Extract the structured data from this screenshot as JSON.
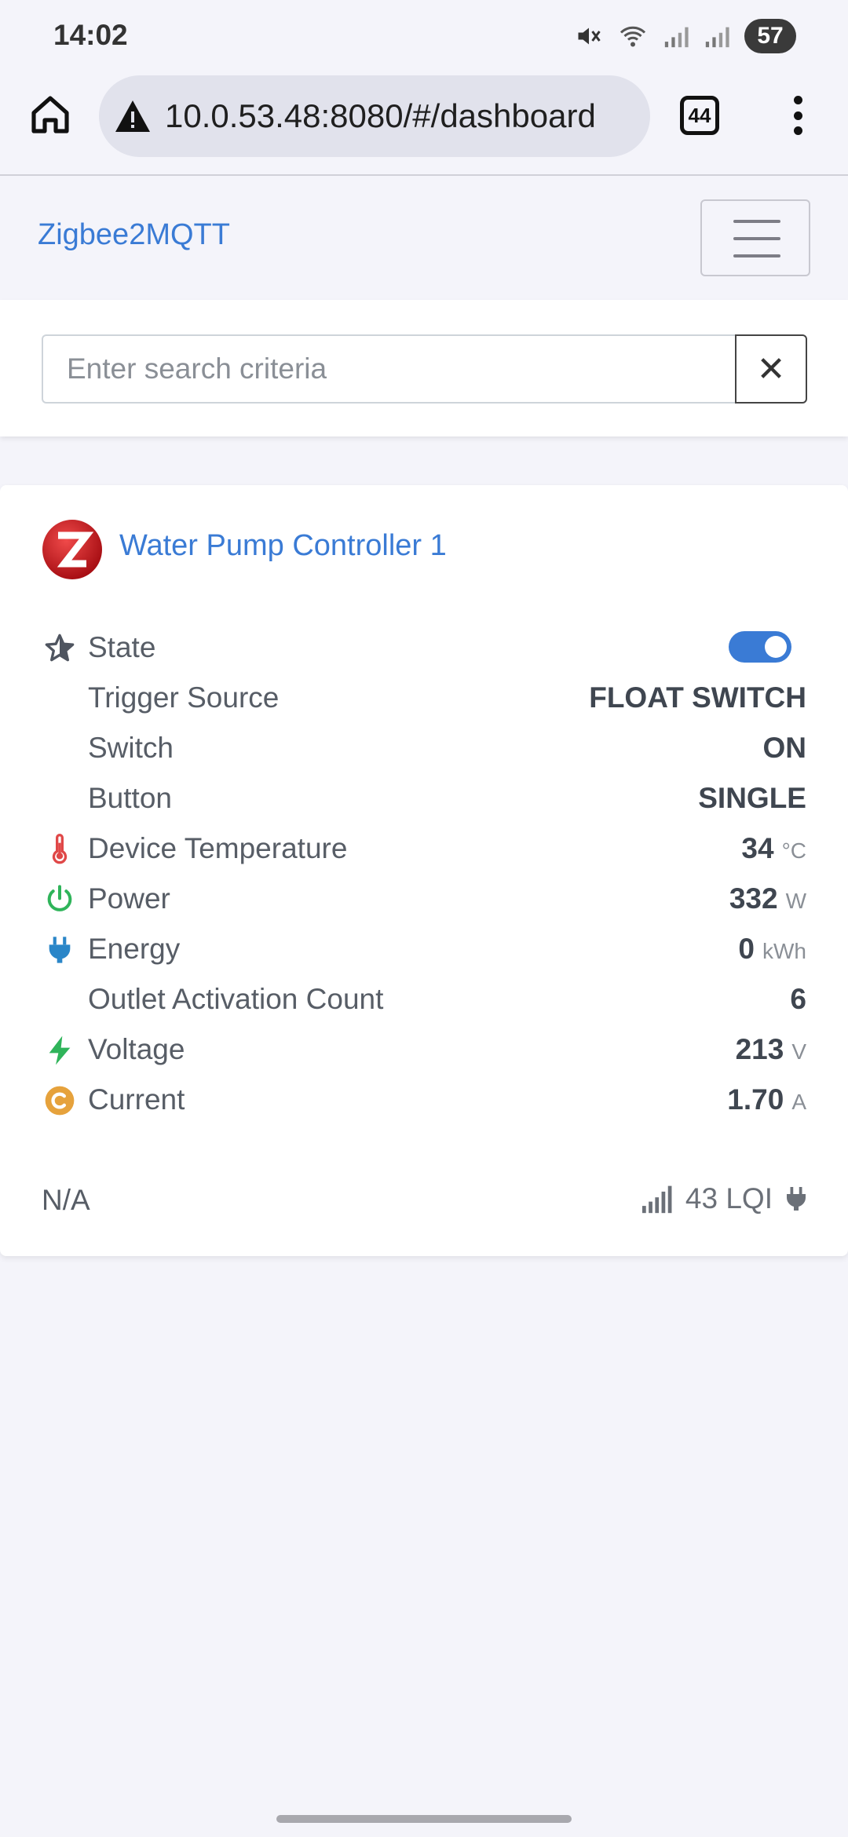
{
  "status_bar": {
    "time": "14:02",
    "battery": "57",
    "icons": [
      "mute-icon",
      "wifi-icon",
      "signal-icon",
      "signal-icon"
    ]
  },
  "browser": {
    "url": "10.0.53.48:8080/#/dashboard",
    "tab_count": "44"
  },
  "navbar": {
    "brand": "Zigbee2MQTT"
  },
  "search": {
    "placeholder": "Enter search criteria",
    "clear_label": "✕"
  },
  "device": {
    "name": "Water Pump Controller 1",
    "state_on": true,
    "rows": [
      {
        "label": "State",
        "value": "",
        "unit": "",
        "icon": "star-icon"
      },
      {
        "label": "Trigger Source",
        "value": "FLOAT SWITCH",
        "unit": "",
        "icon": ""
      },
      {
        "label": "Switch",
        "value": "ON",
        "unit": "",
        "icon": ""
      },
      {
        "label": "Button",
        "value": "SINGLE",
        "unit": "",
        "icon": ""
      },
      {
        "label": "Device Temperature",
        "value": "34",
        "unit": "°C",
        "icon": "thermometer-icon"
      },
      {
        "label": "Power",
        "value": "332",
        "unit": "W",
        "icon": "power-icon"
      },
      {
        "label": "Energy",
        "value": "0",
        "unit": "kWh",
        "icon": "plug-icon"
      },
      {
        "label": "Outlet Activation Count",
        "value": "6",
        "unit": "",
        "icon": ""
      },
      {
        "label": "Voltage",
        "value": "213",
        "unit": "V",
        "icon": "bolt-icon"
      },
      {
        "label": "Current",
        "value": "1.70",
        "unit": "A",
        "icon": "current-icon"
      }
    ],
    "footer": {
      "left": "N/A",
      "lqi": "43 LQI"
    }
  },
  "colors": {
    "accent": "#3a7bd5",
    "thermometer": "#e04848",
    "power": "#2fb45a",
    "plug": "#2a86c8",
    "bolt": "#2fb45a",
    "current": "#e6a23c"
  }
}
